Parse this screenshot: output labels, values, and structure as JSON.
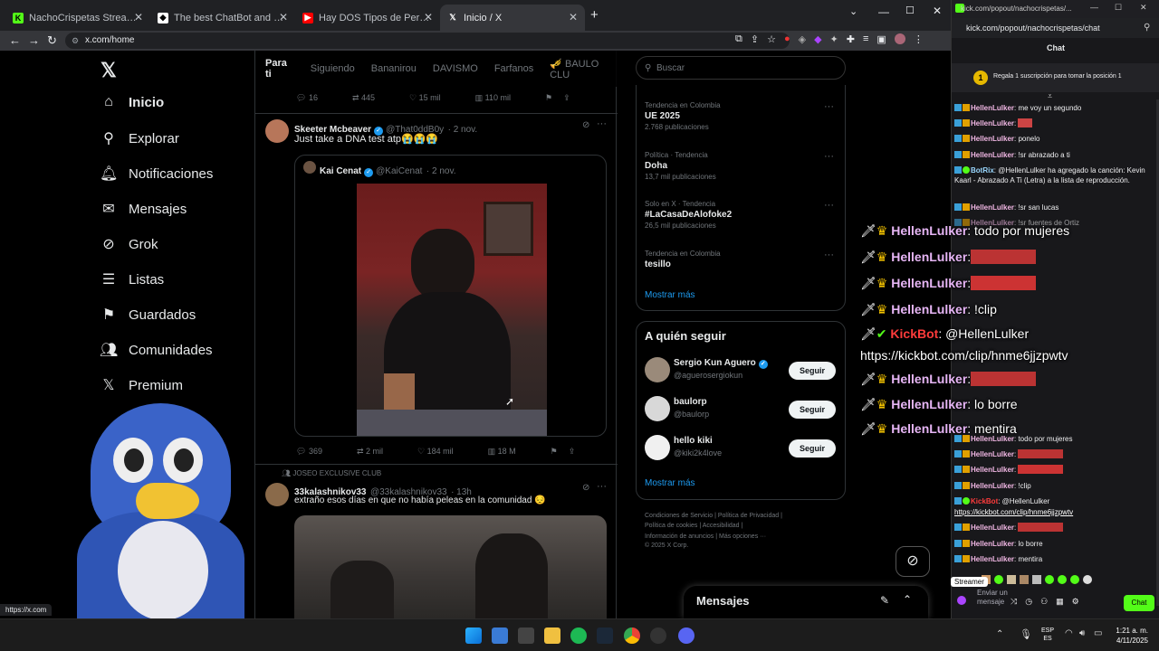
{
  "browser": {
    "tabs": [
      {
        "label": "NachoCrispetas Stream - Watch Li",
        "active": false
      },
      {
        "label": "The best ChatBot and Widgets fo",
        "active": false
      },
      {
        "label": "Hay DOS Tipos de Personas - ¿Cu",
        "active": false
      },
      {
        "label": "Inicio / X",
        "active": true
      }
    ],
    "new_tab": "+",
    "url": "x.com/home",
    "status_url": "https://x.com"
  },
  "x": {
    "nav": [
      {
        "label": "Inicio",
        "icon": "home-icon"
      },
      {
        "label": "Explorar",
        "icon": "search-icon"
      },
      {
        "label": "Notificaciones",
        "icon": "bell-icon"
      },
      {
        "label": "Mensajes",
        "icon": "mail-icon"
      },
      {
        "label": "Grok",
        "icon": "grok-icon"
      },
      {
        "label": "Listas",
        "icon": "list-icon"
      },
      {
        "label": "Guardados",
        "icon": "bookmark-icon"
      },
      {
        "label": "Comunidades",
        "icon": "people-icon"
      },
      {
        "label": "Premium",
        "icon": "x-logo-icon"
      }
    ],
    "feed_tabs": [
      "Para ti",
      "Siguiendo",
      "Bananirou",
      "DAVISMO",
      "Farfanos",
      "🎺 BAULO CLU"
    ],
    "top_actions": {
      "replies": "16",
      "reposts": "445",
      "likes": "15 mil",
      "views": "110 mil"
    },
    "tweet1": {
      "name": "Skeeter Mcbeaver",
      "handle": "@That0ddB0y",
      "time": "· 2 nov.",
      "text": "Just take a DNA test atp😭😭😭",
      "quote": {
        "name": "Kai Cenat",
        "handle": "@KaiCenat",
        "time": "· 2 nov."
      },
      "actions": {
        "replies": "369",
        "reposts": "2 mil",
        "likes": "184 mil",
        "views": "18 M"
      }
    },
    "tweet2": {
      "community": "JOSEO EXCLUSIVE CLUB",
      "name": "33kalashnikov33",
      "handle": "@33kalashnikov33",
      "time": "· 13h",
      "text": "extraño esos días en que no había peleas en la comunidad 😔"
    },
    "search_placeholder": "Buscar",
    "trends": [
      {
        "meta": "Tendencia en Colombia",
        "title": "UE 2025",
        "count": "2.768 publicaciones"
      },
      {
        "meta": "Política · Tendencia",
        "title": "Doha",
        "count": "13,7 mil publicaciones"
      },
      {
        "meta": "Solo en X · Tendencia",
        "title": "#LaCasaDeAlofoke2",
        "count": "26,5 mil publicaciones"
      },
      {
        "meta": "Tendencia en Colombia",
        "title": "tesillo",
        "count": ""
      }
    ],
    "show_more": "Mostrar más",
    "who_to_follow": "A quién seguir",
    "follow": [
      {
        "name": "Sergio Kun Aguero",
        "handle": "@aguerosergiokun",
        "button": "Seguir"
      },
      {
        "name": "baulorp",
        "handle": "@baulorp",
        "button": "Seguir"
      },
      {
        "name": "hello kiki",
        "handle": "@kiki2k4love",
        "button": "Seguir"
      }
    ],
    "footer": [
      "Condiciones de Servicio",
      "|",
      "Política de Privacidad",
      "|",
      "Política de cookies",
      "|",
      "Accesibilidad",
      "|",
      "Información de anuncios",
      "|",
      "Más opciones ···",
      "© 2025 X Corp."
    ],
    "messages": "Mensajes"
  },
  "kick": {
    "url": "kick.com/popout/nachocrispetas/chat",
    "title_url": "kick.com/popout/nachocrispetas/...",
    "heading": "Chat",
    "gift_banner": "Regala 1 suscripción para tomar la posición 1",
    "lines": [
      {
        "user": "HellenLulker",
        "msg": ": me voy un segundo"
      },
      {
        "user": "HellenLulker",
        "msg": ":"
      },
      {
        "user": "HellenLulker",
        "msg": ": ponelo"
      },
      {
        "user": "HellenLulker",
        "msg": ": !sr abrazado a ti"
      },
      {
        "user": "BotRix",
        "msg": ": @HellenLulker ha agregado la canción: Kevin Kaarl - Abrazado A Ti (Letra) a la lista de reproducción."
      },
      {
        "user": "HellenLulker",
        "msg": ": !sr san lucas"
      },
      {
        "user": "HellenLulker",
        "msg": ": !sr fuentes de Ortiz"
      },
      {
        "user": "HellenLulker",
        "msg": ": todo por mujeres"
      },
      {
        "user": "HellenLulker",
        "msg": ":"
      },
      {
        "user": "HellenLulker",
        "msg": ":"
      },
      {
        "user": "HellenLulker",
        "msg": ": !clip"
      },
      {
        "user": "KickBot",
        "msg": ": @HellenLulker"
      },
      {
        "user": "",
        "msg": "https://kickbot.com/clip/hnme6jjzpwtv"
      },
      {
        "user": "HellenLulker",
        "msg": ":"
      },
      {
        "user": "HellenLulker",
        "msg": ": lo borre"
      },
      {
        "user": "HellenLulker",
        "msg": ": mentira"
      }
    ],
    "input_placeholder": "Enviar un mensaje",
    "streamer_badge": "Streamer",
    "chat_button": "Chat"
  },
  "overlay": [
    {
      "user": "HellenLulker",
      "msg": ": todo por mujeres"
    },
    {
      "user": "HellenLulker",
      "msg": ":"
    },
    {
      "user": "HellenLulker",
      "msg": ":"
    },
    {
      "user": "HellenLulker",
      "msg": ": !clip"
    },
    {
      "user": "KickBot",
      "msg": ": @HellenLulker"
    },
    {
      "user": "",
      "msg": "https://kickbot.com/clip/hnme6jjzpwtv"
    },
    {
      "user": "HellenLulker",
      "msg": ":"
    },
    {
      "user": "HellenLulker",
      "msg": ": lo borre"
    },
    {
      "user": "HellenLulker",
      "msg": ": mentira"
    }
  ],
  "taskbar": {
    "lang": "ESP",
    "lang2": "ES",
    "time": "1:21 a. m.",
    "date": "4/11/2025"
  },
  "colors": {
    "accent": "#1d9bf0",
    "kick_green": "#53fc18",
    "chat_user": "#f1b7e4"
  }
}
